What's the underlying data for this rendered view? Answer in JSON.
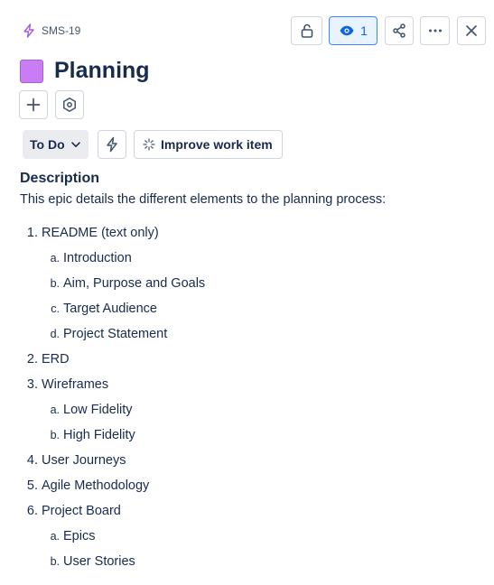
{
  "header": {
    "issue_key": "SMS-19",
    "watch_count": "1"
  },
  "issue": {
    "title": "Planning",
    "color": "#c97cf4"
  },
  "actions": {
    "status": "To Do",
    "improve_label": "Improve work item"
  },
  "description": {
    "heading": "Description",
    "intro": "This epic details the different elements to the planning process:",
    "items": [
      {
        "marker": "1.",
        "text": "README (text only)",
        "level": 1
      },
      {
        "marker": "a.",
        "text": "Introduction",
        "level": 2
      },
      {
        "marker": "b.",
        "text": "Aim, Purpose and Goals",
        "level": 2
      },
      {
        "marker": "c.",
        "text": "Target Audience",
        "level": 2
      },
      {
        "marker": "d.",
        "text": "Project Statement",
        "level": 2
      },
      {
        "marker": "2.",
        "text": "ERD",
        "level": 1
      },
      {
        "marker": "3.",
        "text": "Wireframes",
        "level": 1
      },
      {
        "marker": "a.",
        "text": "Low Fidelity",
        "level": 2
      },
      {
        "marker": "b.",
        "text": "High Fidelity",
        "level": 2
      },
      {
        "marker": "4.",
        "text": "User Journeys",
        "level": 1
      },
      {
        "marker": "5.",
        "text": "Agile Methodology",
        "level": 1
      },
      {
        "marker": "6.",
        "text": "Project Board",
        "level": 1
      },
      {
        "marker": "a.",
        "text": "Epics",
        "level": 2
      },
      {
        "marker": "b.",
        "text": "User Stories",
        "level": 2
      }
    ]
  },
  "icons": [
    "epic-bolt-icon",
    "unlock-icon",
    "eye-icon",
    "share-icon",
    "more-icon",
    "close-icon",
    "plus-icon",
    "hexagon-icon",
    "chevron-down-icon",
    "automation-bolt-icon",
    "sparkle-icon"
  ]
}
